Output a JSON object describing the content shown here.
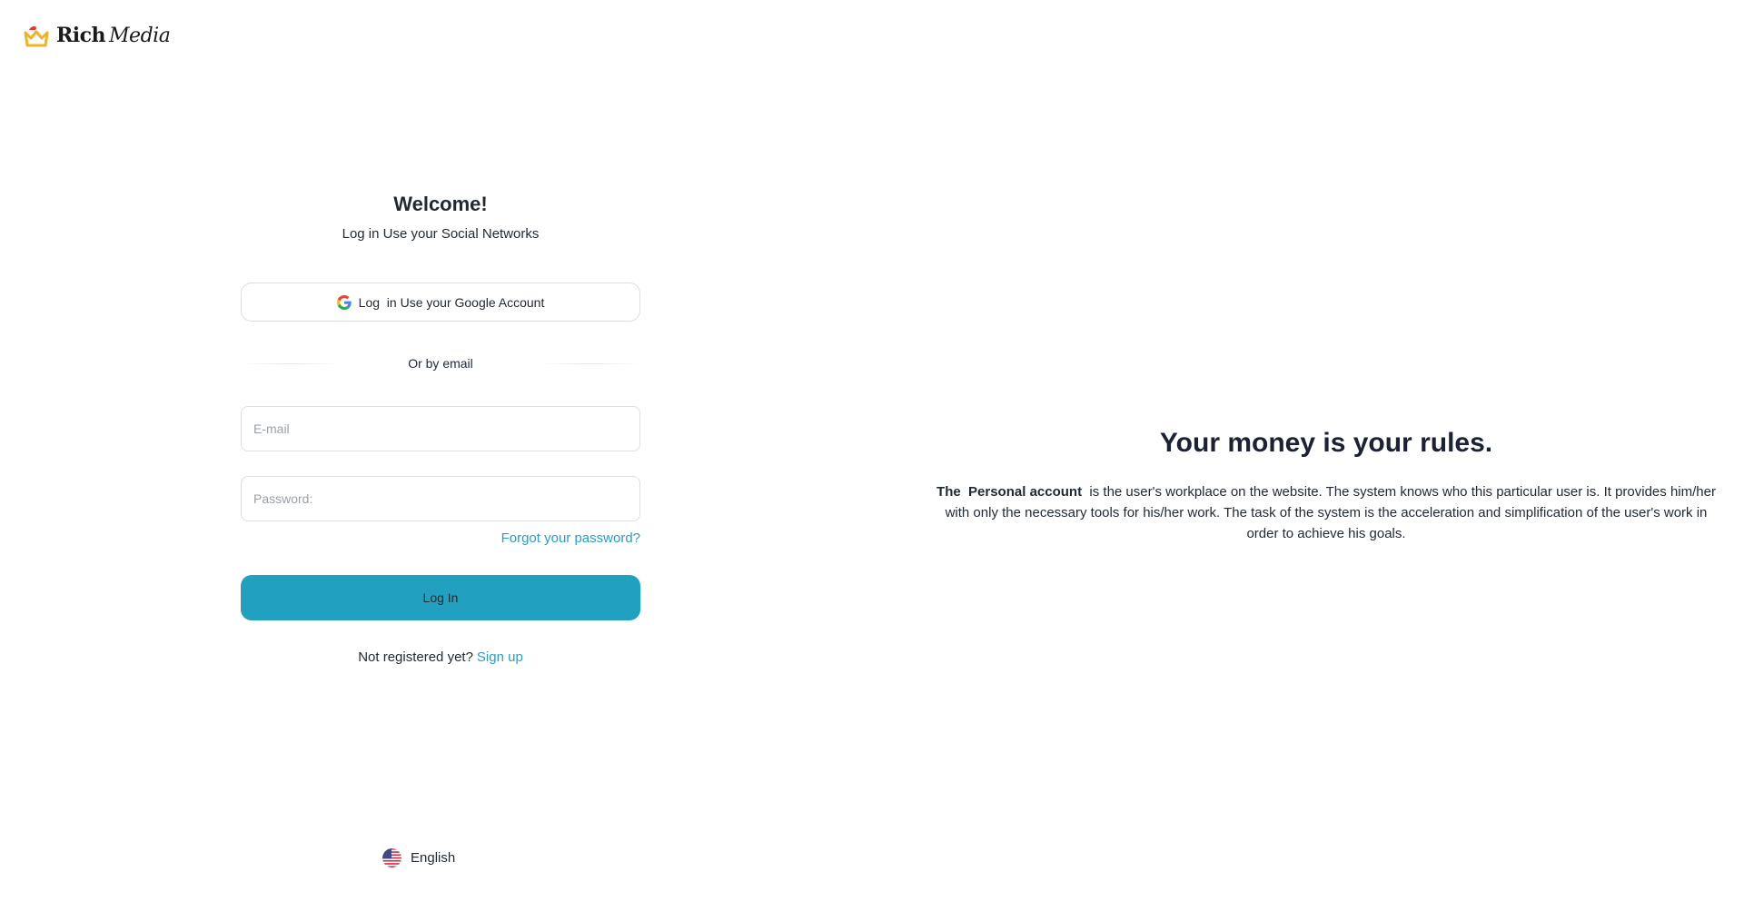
{
  "brand": {
    "name_bold": "Rich",
    "name_italic": "Media",
    "logo_icon": "crown-icon",
    "accent_color": "#f0b323",
    "hat_color": "#e03a2f"
  },
  "login": {
    "title": "Welcome!",
    "subtitle": "Log in Use your Social Networks",
    "google_label": "Log  in Use your Google Account",
    "divider_text": "Or by email",
    "email_placeholder": "E-mail",
    "password_placeholder": "Password:",
    "forgot_password": "Forgot your password?",
    "submit_label": "Log In",
    "register_prompt": "Not registered yet?",
    "register_link": "Sign up",
    "primary_color": "#22a0bf",
    "link_color": "#2a9fc0"
  },
  "language": {
    "selected": "English",
    "flag_icon": "us-flag-icon"
  },
  "promo": {
    "title": "Your money is your rules.",
    "text_lead": "The  Personal account ",
    "text_body": " is the user's workplace on the website. The system knows who this particular user is. It provides him/her with only the necessary tools for his/her work. The task of the system is the acceleration and simplification of the user's work in order to achieve his goals."
  }
}
